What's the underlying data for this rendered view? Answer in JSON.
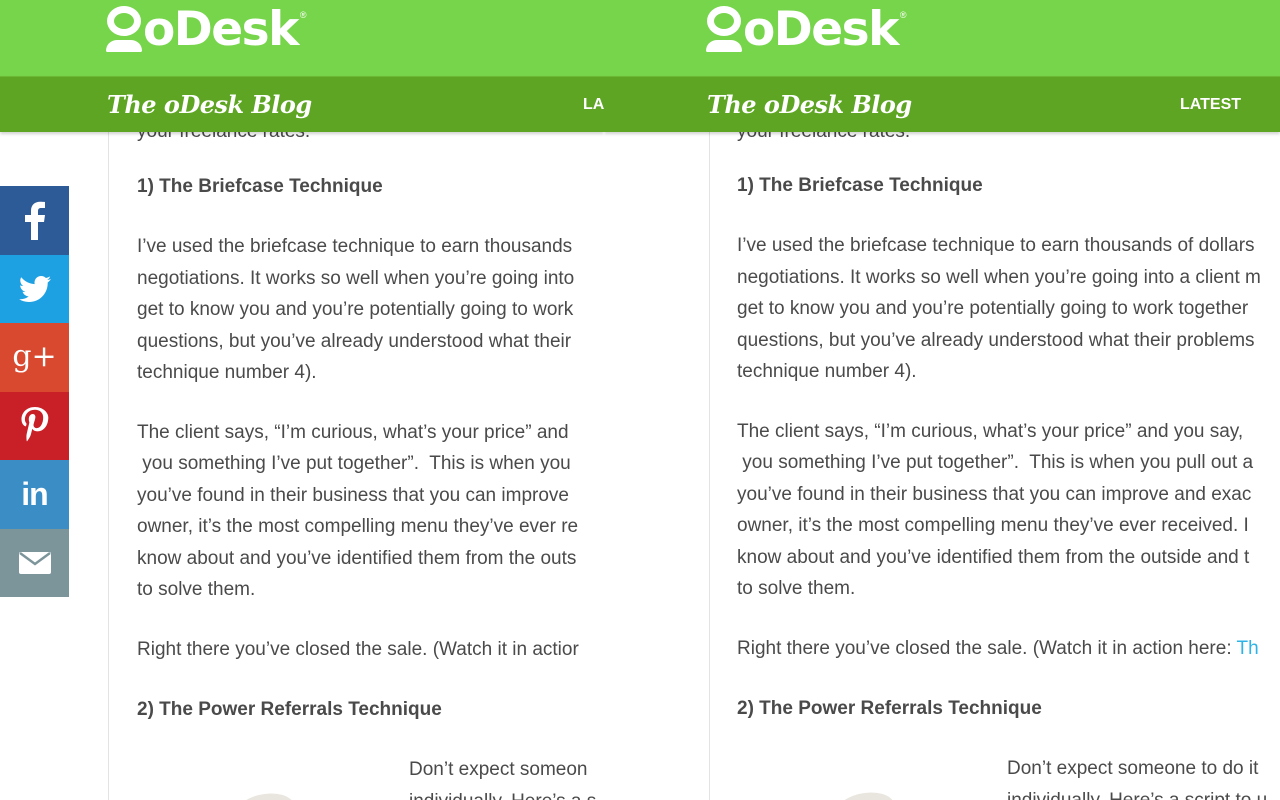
{
  "brand": {
    "logo_text": "oDesk",
    "registered_mark": "®",
    "blog_title": "The oDesk Blog"
  },
  "colors": {
    "header_green": "#77d54b",
    "subheader_green": "#5ea523",
    "body_text": "#4a4a4a",
    "link_blue": "#2eb3e6"
  },
  "left_pane": {
    "nav_latest": "LA",
    "cut_line": "your freelance rates.",
    "heading_1": "1) The Briefcase Technique",
    "para_1": [
      "I’ve used the briefcase technique to earn thousands",
      "negotiations. It works so well when you’re going into",
      "get to know you and you’re potentially going to work",
      "questions, but you’ve already understood what their",
      "technique number 4)."
    ],
    "para_2": [
      "The client says, “I’m curious, what’s your price” and",
      " you something I’ve put together”.  This is when you",
      "you’ve found in their business that you can improve",
      "owner, it’s the most compelling menu they’ve ever re",
      "know about and you’ve identified them from the outs",
      "to solve them."
    ],
    "para_3": "Right there you’ve closed the sale. (Watch it in actior",
    "heading_2": "2) The Power Referrals Technique",
    "side_text": [
      "Don’t expect someon",
      "individually. Here’s a s"
    ]
  },
  "right_pane": {
    "nav_latest": "LATEST",
    "cut_line": "your freelance rates.",
    "heading_1": "1) The Briefcase Technique",
    "para_1": [
      "I’ve used the briefcase technique to earn thousands of dollars",
      "negotiations. It works so well when you’re going into a client m",
      "get to know you and you’re potentially going to work together",
      "questions, but you’ve already understood what their problems",
      "technique number 4)."
    ],
    "para_2": [
      "The client says, “I’m curious, what’s your price” and you say,",
      " you something I’ve put together”.  This is when you pull out a",
      "you’ve found in their business that you can improve and exac",
      "owner, it’s the most compelling menu they’ve ever received.  I",
      "know about and you’ve identified them from the outside and t",
      "to solve them."
    ],
    "para_3": "Right there you’ve closed the sale. (Watch it in action here: ",
    "para_3_link": "Th",
    "heading_2": "2) The Power Referrals Technique",
    "side_text": [
      "Don’t expect someone to do it",
      "individually. Here’s a script to u"
    ]
  },
  "share_bar": [
    {
      "network": "facebook",
      "icon": "facebook-icon",
      "glyph": "f"
    },
    {
      "network": "twitter",
      "icon": "twitter-bird-icon"
    },
    {
      "network": "google-plus",
      "icon": "google-plus-icon",
      "glyph": "g+"
    },
    {
      "network": "pinterest",
      "icon": "pinterest-icon",
      "glyph": "P"
    },
    {
      "network": "linkedin",
      "icon": "linkedin-icon",
      "glyph": "in"
    },
    {
      "network": "email",
      "icon": "envelope-icon"
    }
  ]
}
